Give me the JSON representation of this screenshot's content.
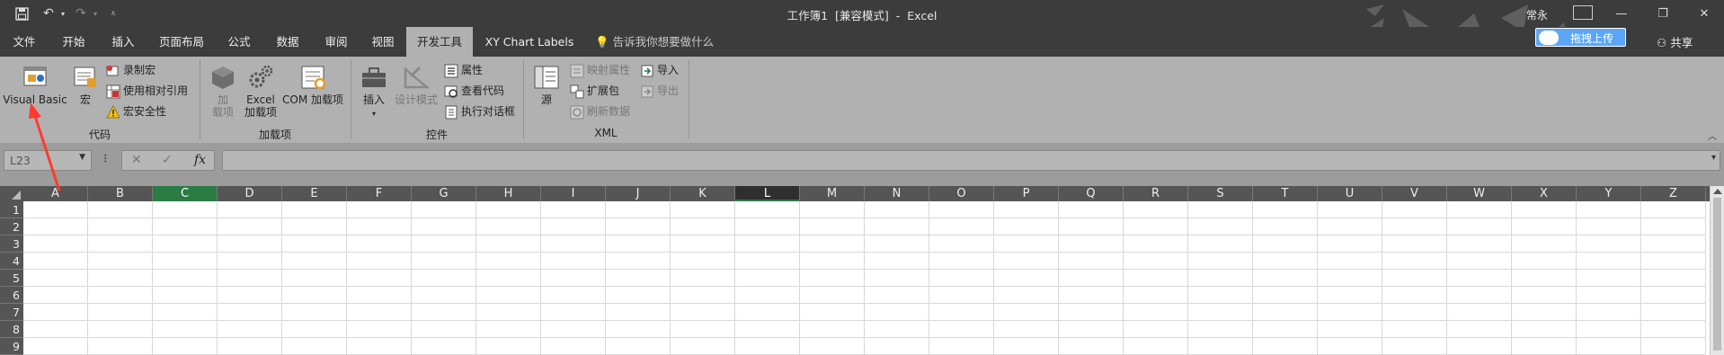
{
  "title": {
    "doc": "工作簿1",
    "mode": "[兼容模式]",
    "dash": "-",
    "app": "Excel"
  },
  "user": "常永",
  "tabs": [
    {
      "label": "文件"
    },
    {
      "label": "开始"
    },
    {
      "label": "插入"
    },
    {
      "label": "页面布局"
    },
    {
      "label": "公式"
    },
    {
      "label": "数据"
    },
    {
      "label": "审阅"
    },
    {
      "label": "视图"
    },
    {
      "label": "开发工具",
      "active": true
    },
    {
      "label": "XY Chart Labels"
    }
  ],
  "tellme": "告诉我你想要做什么",
  "baidu_upload": "拖拽上传",
  "share": "共享",
  "ribbon": {
    "code": {
      "label": "代码",
      "visual_basic": "Visual Basic",
      "macro": "宏",
      "record_macro": "录制宏",
      "relative_ref": "使用相对引用",
      "macro_security": "宏安全性"
    },
    "addins": {
      "label": "加载项",
      "addin_line1": "加",
      "addin_line2": "载项",
      "excel_addin_line1": "Excel",
      "excel_addin_line2": "加载项",
      "com_addin": "COM 加载项"
    },
    "controls": {
      "label": "控件",
      "insert": "插入",
      "design_mode": "设计模式",
      "properties": "属性",
      "view_code": "查看代码",
      "run_dialog": "执行对话框"
    },
    "xml": {
      "label": "XML",
      "source": "源",
      "map_properties": "映射属性",
      "expansion_packs": "扩展包",
      "refresh_data": "刷新数据",
      "import": "导入",
      "export": "导出"
    }
  },
  "formula_bar": {
    "name_box": "L23",
    "cancel": "✕",
    "enter": "✓",
    "fx": "fx",
    "formula": ""
  },
  "columns": [
    "A",
    "B",
    "C",
    "D",
    "E",
    "F",
    "G",
    "H",
    "I",
    "J",
    "K",
    "L",
    "M",
    "N",
    "O",
    "P",
    "Q",
    "R",
    "S",
    "T",
    "U",
    "V",
    "W",
    "X",
    "Y",
    "Z"
  ],
  "rows": [
    "1",
    "2",
    "3",
    "4",
    "5",
    "6",
    "7",
    "8",
    "9"
  ],
  "colors": {
    "titlebar": "#3c3c3c",
    "ribbon": "#b1b1b1",
    "selected_col": "#2a7c44",
    "annotation": "#ff3b30",
    "baidu": "#5ba7f5"
  }
}
